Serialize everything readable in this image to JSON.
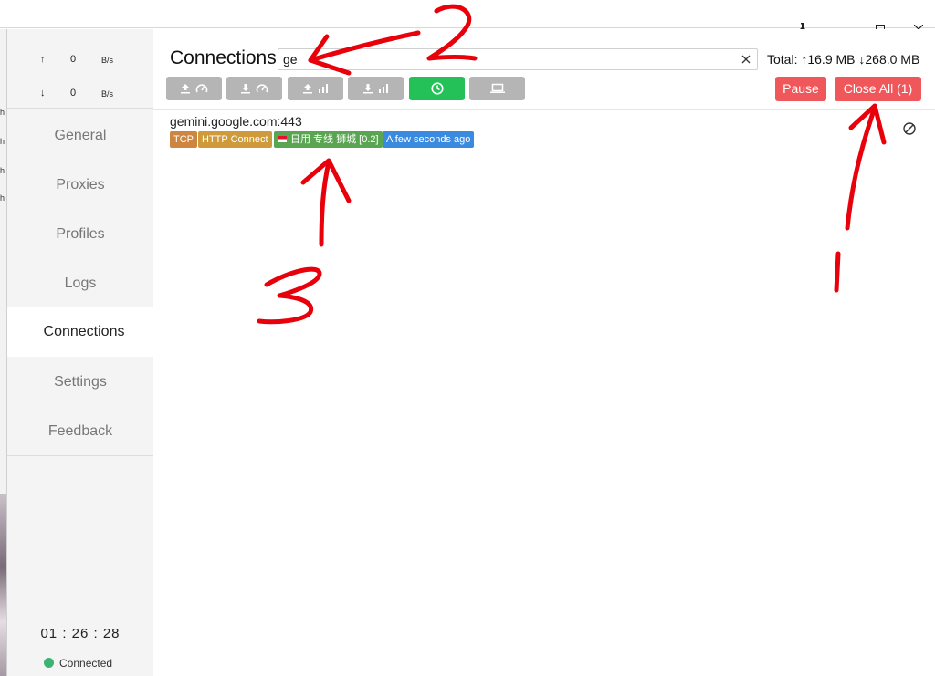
{
  "sidebar": {
    "upload": {
      "arrow": "↑",
      "value": "0",
      "unit": "B/s"
    },
    "download": {
      "arrow": "↓",
      "value": "0",
      "unit": "B/s"
    },
    "items": [
      {
        "label": "General"
      },
      {
        "label": "Proxies"
      },
      {
        "label": "Profiles"
      },
      {
        "label": "Logs"
      },
      {
        "label": "Connections",
        "active": true
      },
      {
        "label": "Settings"
      },
      {
        "label": "Feedback"
      }
    ],
    "timer": "01 : 26 : 28",
    "status": "Connected",
    "status_color": "#3cb371"
  },
  "window_controls": [
    {
      "icon": "pin-icon",
      "glyph": "📌"
    },
    {
      "icon": "minimize-icon",
      "glyph": "—"
    },
    {
      "icon": "maximize-icon",
      "glyph": "☐"
    },
    {
      "icon": "close-icon",
      "glyph": "✕"
    }
  ],
  "main": {
    "title": "Connections",
    "search": {
      "value": "ge",
      "clear_glyph": "✕"
    },
    "total": "Total: ↑16.9 MB ↓268.0 MB",
    "toolbar": [
      {
        "name": "sort-upload-speed",
        "icons": [
          "upload-icon",
          "speedometer-icon"
        ]
      },
      {
        "name": "sort-download-speed",
        "icons": [
          "download-icon",
          "speedometer-icon"
        ]
      },
      {
        "name": "sort-upload-total",
        "icons": [
          "upload-icon",
          "bar-chart-icon"
        ]
      },
      {
        "name": "sort-download-total",
        "icons": [
          "download-icon",
          "bar-chart-icon"
        ]
      },
      {
        "name": "sort-time",
        "icons": [
          "clock-icon"
        ],
        "active": true
      },
      {
        "name": "sort-process",
        "icons": [
          "laptop-icon"
        ]
      }
    ],
    "pause_label": "Pause",
    "close_all_label": "Close All (1)",
    "accent_red": "#f0575b",
    "accent_green": "#23c157",
    "connections": [
      {
        "host": "gemini.google.com:443",
        "tags": {
          "network": "TCP",
          "type": "HTTP Connect",
          "chain": "日用 专线 狮城 [0.2]",
          "time": "A few seconds ago"
        }
      }
    ]
  },
  "annotations": [
    "1",
    "2",
    "3"
  ]
}
